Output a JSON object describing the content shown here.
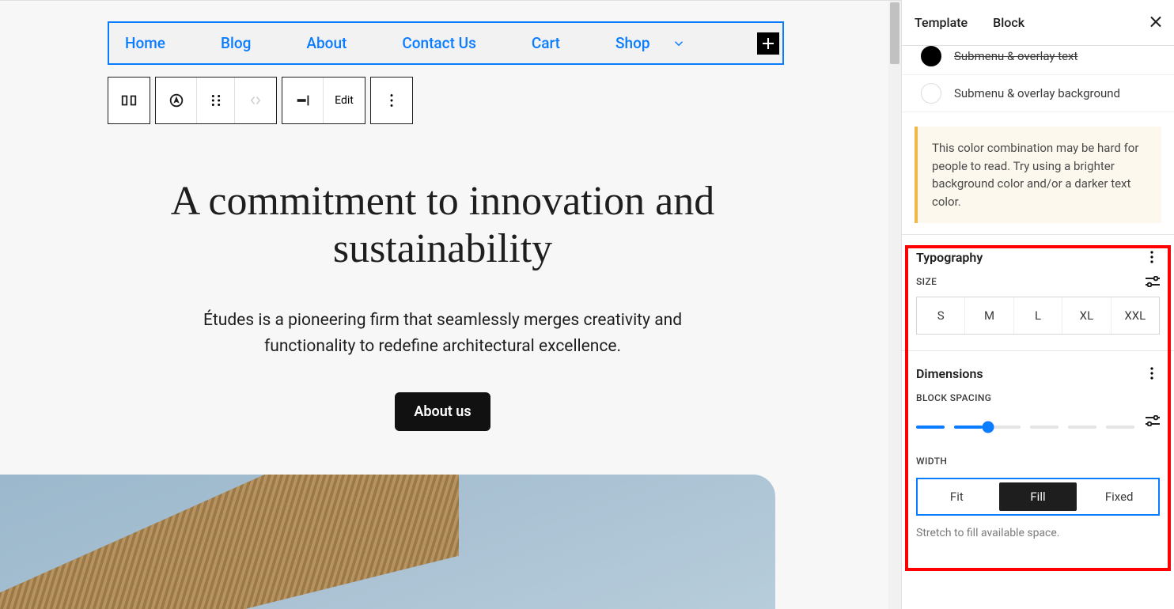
{
  "nav": {
    "items": [
      "Home",
      "Blog",
      "About",
      "Contact Us",
      "Cart",
      "Shop"
    ]
  },
  "toolbar": {
    "edit_label": "Edit"
  },
  "hero": {
    "heading": "A commitment to innovation and sustainability",
    "para": "Études is a pioneering firm that seamlessly merges creativity and functionality to redefine architectural excellence.",
    "button": "About us"
  },
  "sidebar": {
    "tabs": {
      "template": "Template",
      "block": "Block"
    },
    "color_rows": {
      "overlay_text": "Submenu & overlay text",
      "overlay_bg": "Submenu & overlay background"
    },
    "warning": "This color combination may be hard for people to read. Try using a brighter background color and/or a darker text color.",
    "typography": {
      "title": "Typography",
      "size_label": "Size",
      "sizes": [
        "S",
        "M",
        "L",
        "XL",
        "XXL"
      ]
    },
    "dimensions": {
      "title": "Dimensions",
      "spacing_label": "Block Spacing",
      "width_label": "Width",
      "width_opts": [
        "Fit",
        "Fill",
        "Fixed"
      ],
      "helper": "Stretch to fill available space."
    }
  }
}
